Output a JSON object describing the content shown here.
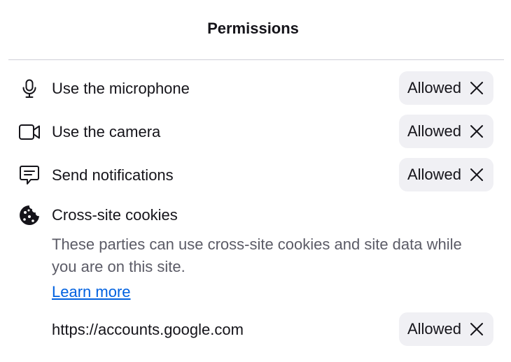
{
  "header": {
    "title": "Permissions"
  },
  "permissions": [
    {
      "label": "Use the microphone",
      "icon": "microphone-icon",
      "status": "Allowed"
    },
    {
      "label": "Use the camera",
      "icon": "camera-icon",
      "status": "Allowed"
    },
    {
      "label": "Send notifications",
      "icon": "notification-icon",
      "status": "Allowed"
    }
  ],
  "cookies": {
    "title": "Cross-site cookies",
    "icon": "cookie-icon",
    "description": "These parties can use cross-site cookies and site data while you are on this site.",
    "learn_more": "Learn more",
    "sites": [
      {
        "origin": "https://accounts.google.com",
        "status": "Allowed"
      }
    ]
  },
  "colors": {
    "text": "#15141a",
    "secondary_text": "#5b5b66",
    "link": "#0061e0",
    "pill_bg": "#f0f0f4",
    "divider": "#cfcfd8"
  }
}
